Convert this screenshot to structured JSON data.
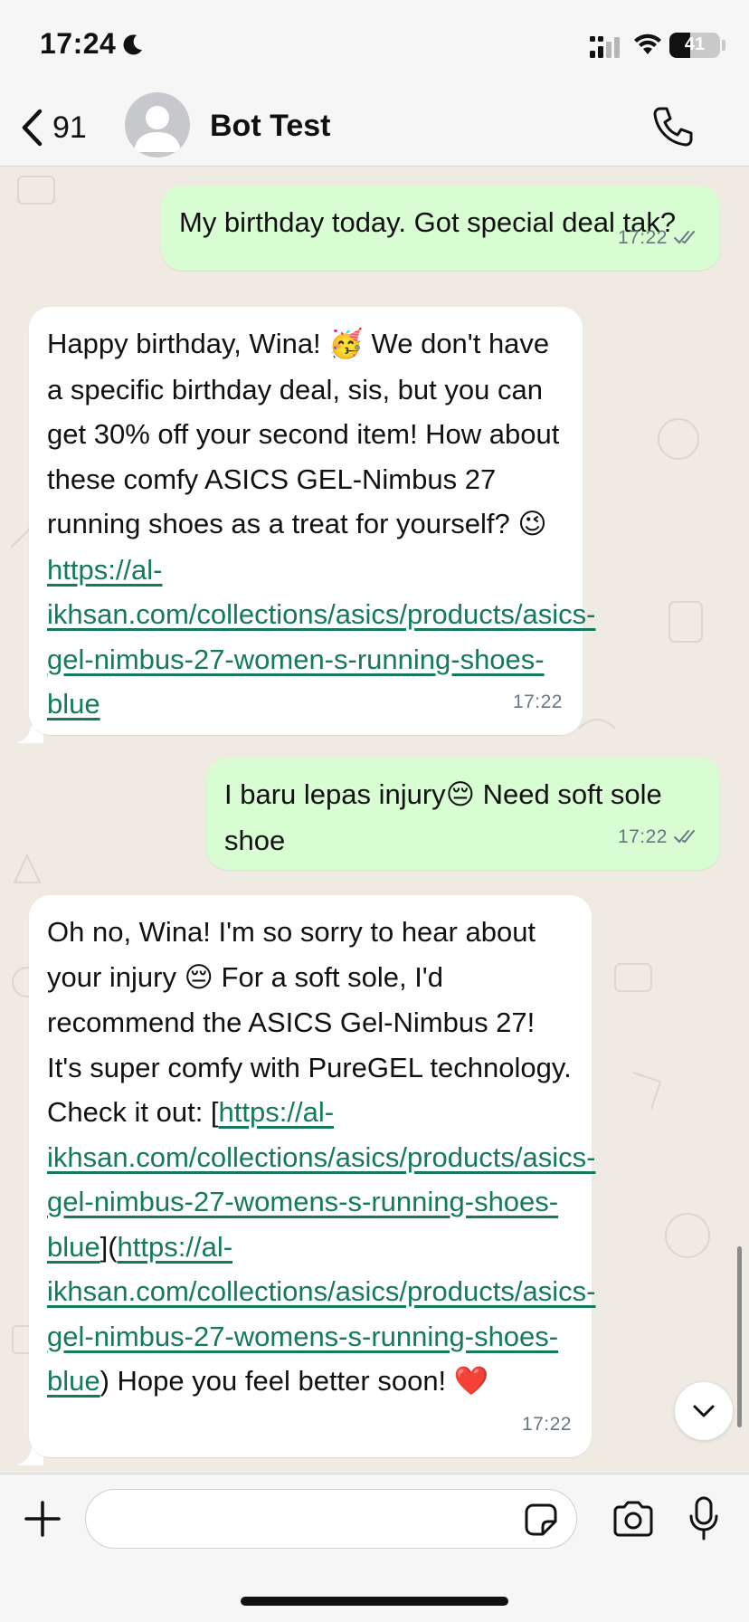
{
  "status_bar": {
    "time": "17:24",
    "battery": "41",
    "battery_level": 0.41,
    "icons": [
      "moon-icon",
      "signal-icon",
      "wifi-icon",
      "battery-icon"
    ]
  },
  "header": {
    "back_count": "91",
    "contact_name": "Bot Test",
    "icons": [
      "chevron-left-icon",
      "avatar-icon",
      "phone-icon"
    ]
  },
  "messages": [
    {
      "direction": "outgoing",
      "text": "My birthday today. Got special deal tak?",
      "time": "17:22",
      "status": "read"
    },
    {
      "direction": "incoming",
      "text_1": "Happy birthday, Wina! ",
      "emoji_1": "🥳",
      "text_2": "  We don't have a specific birthday deal, sis, but you can get 30% off your second item! How about these comfy ASICS GEL-Nimbus 27 running shoes as a treat for yourself? ",
      "emoji_2": "😉",
      "link": "https://al-ikhsan.com/collections/asics/products/asics-gel-nimbus-27-women-s-running-shoes-blue",
      "time": "17:22"
    },
    {
      "direction": "outgoing",
      "text_1": "I baru lepas injury",
      "emoji_1": "😔",
      "text_2": " Need soft sole shoe",
      "time": "17:22",
      "status": "read"
    },
    {
      "direction": "incoming",
      "text_1": "Oh no, Wina! I'm so sorry to hear about your injury ",
      "emoji_1": "😔",
      "text_2": "  For a soft sole, I'd recommend the ASICS Gel-Nimbus 27! It's super comfy with PureGEL technology.  Check it out: [",
      "link_1": "https://al-ikhsan.com/collections/asics/products/asics-gel-nimbus-27-womens-s-running-shoes-blue",
      "text_3": "](",
      "link_2": "https://al-ikhsan.com/collections/asics/products/asics-gel-nimbus-27-womens-s-running-shoes-blue",
      "text_4": ")  Hope you feel better soon! ",
      "emoji_2": "❤️",
      "time": "17:22"
    }
  ],
  "input": {
    "placeholder": "",
    "icons": [
      "plus-icon",
      "sticker-icon",
      "camera-icon",
      "microphone-icon"
    ]
  },
  "colors": {
    "outgoing_bubble": "#d9fdd3",
    "incoming_bubble": "#ffffff",
    "link": "#157a5d",
    "read_ticks": "#667781",
    "chat_background": "#efeae2"
  }
}
